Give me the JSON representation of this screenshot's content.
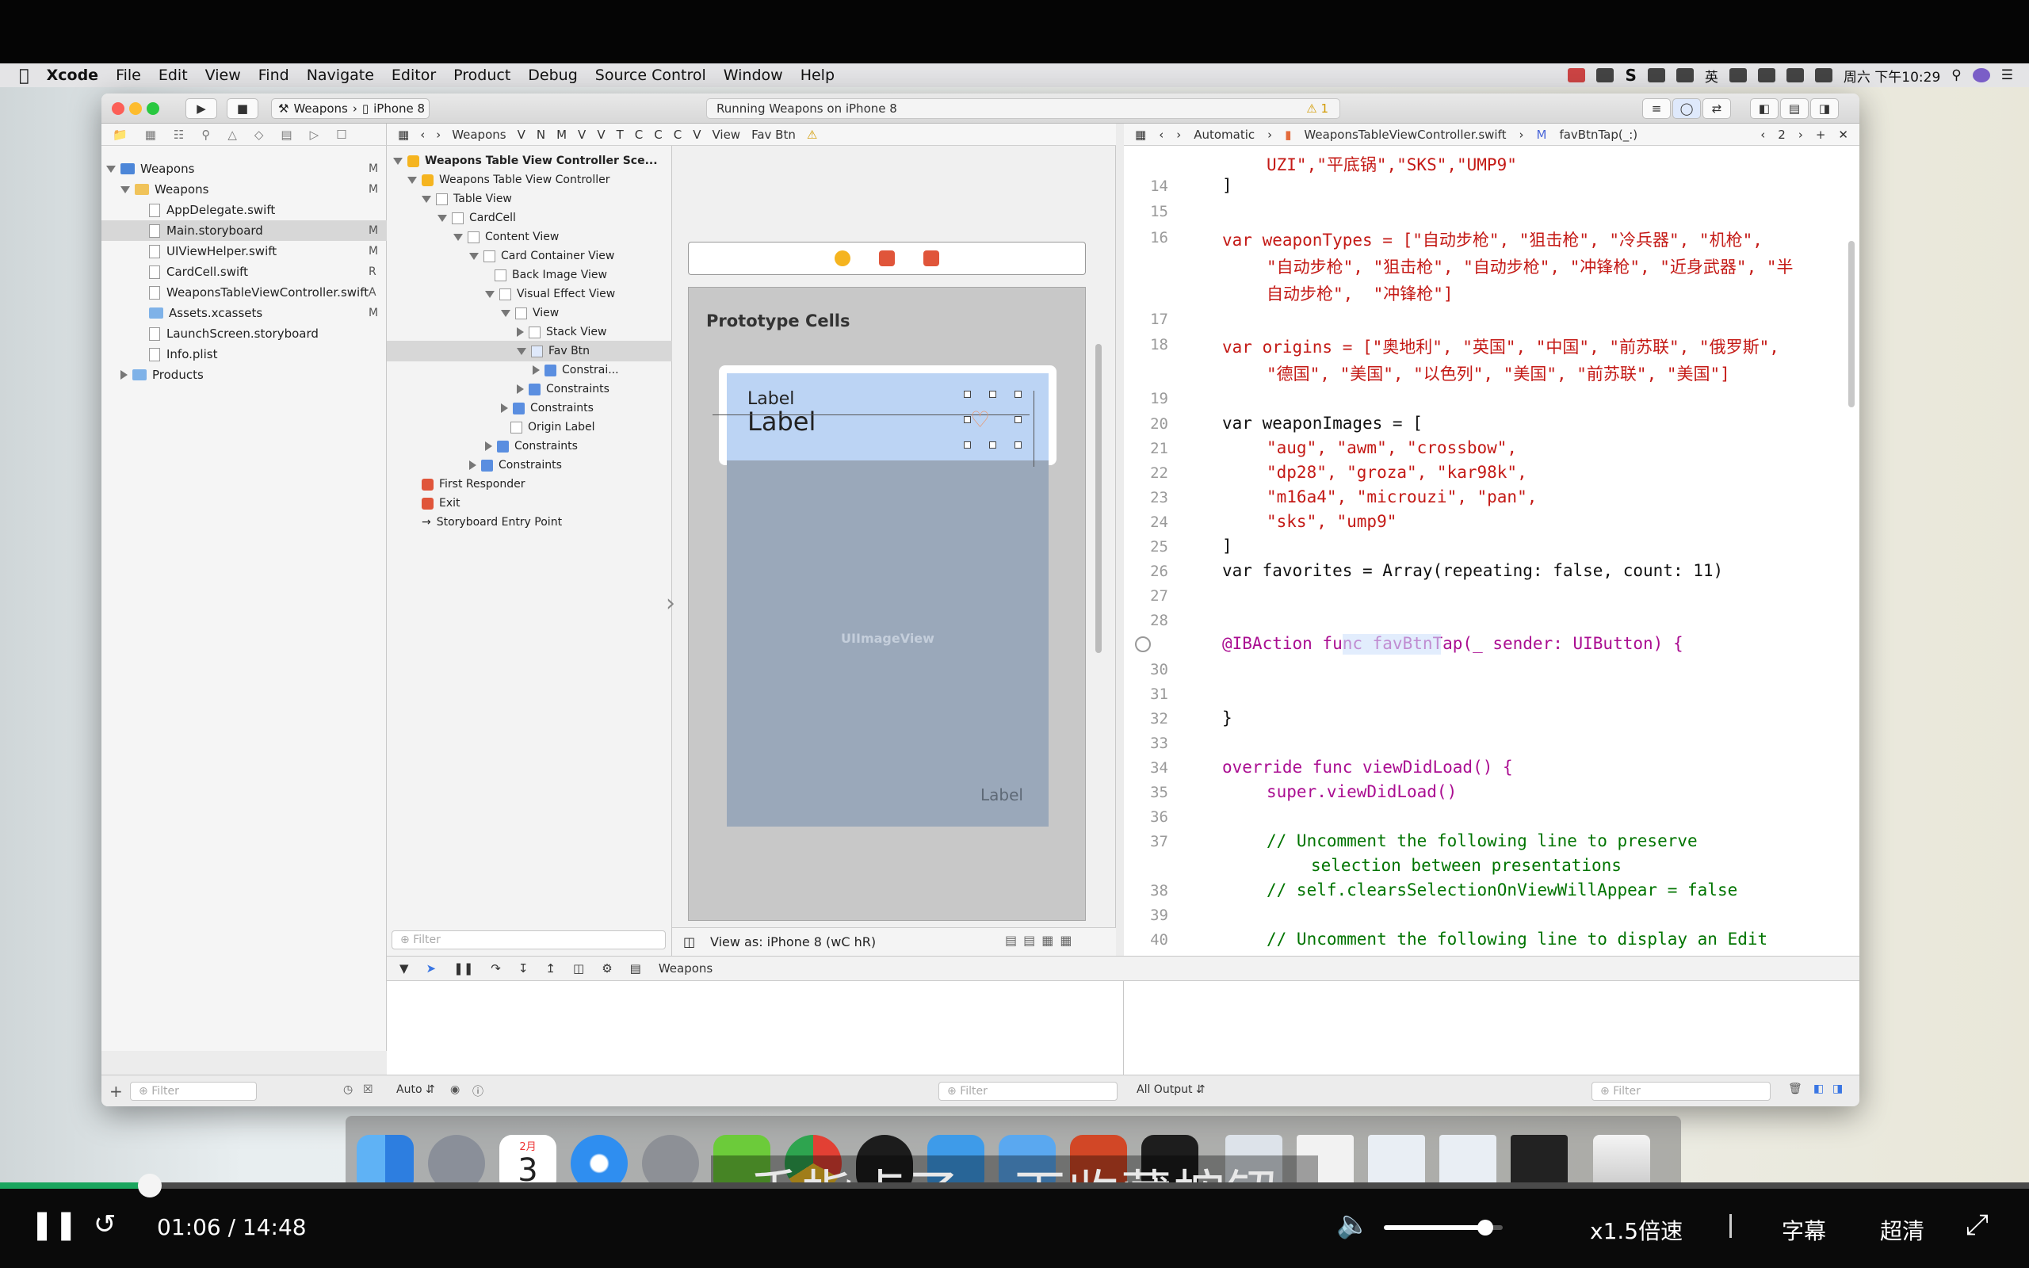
{
  "menubar": {
    "app": "Xcode",
    "items": [
      "File",
      "Edit",
      "View",
      "Find",
      "Navigate",
      "Editor",
      "Product",
      "Debug",
      "Source Control",
      "Window",
      "Help"
    ],
    "clock": "周六 下午10:29",
    "input_method": "英",
    "s_icon": "S"
  },
  "toolbar": {
    "scheme_target": "Weapons",
    "scheme_device": "iPhone 8",
    "status": "Running Weapons on iPhone 8",
    "warnings": "1"
  },
  "navigator": {
    "project": "Weapons",
    "group": "Weapons",
    "files": [
      {
        "name": "AppDelegate.swift",
        "flag": ""
      },
      {
        "name": "Main.storyboard",
        "flag": "M"
      },
      {
        "name": "UIViewHelper.swift",
        "flag": "M"
      },
      {
        "name": "CardCell.swift",
        "flag": "R"
      },
      {
        "name": "WeaponsTableViewController.swift",
        "flag": "A"
      },
      {
        "name": "Assets.xcassets",
        "flag": "M"
      },
      {
        "name": "LaunchScreen.storyboard",
        "flag": ""
      },
      {
        "name": "Info.plist",
        "flag": ""
      }
    ],
    "project_flag": "M",
    "group_flag": "M",
    "products": "Products",
    "filter_placeholder": "Filter"
  },
  "jumpbar": {
    "items": [
      "Weapons",
      "V",
      "N",
      "M",
      "V",
      "V",
      "T",
      "C",
      "C",
      "C",
      "V",
      "View",
      "Fav Btn"
    ]
  },
  "outline": {
    "rows": [
      "Weapons Table View Controller Sce...",
      "Weapons Table View Controller",
      "Table View",
      "CardCell",
      "Content View",
      "Card Container View",
      "Back Image View",
      "Visual Effect View",
      "View",
      "Stack View",
      "Fav Btn",
      "Constrai...",
      "Constraints",
      "Constraints",
      "Origin Label",
      "Constraints",
      "Constraints",
      "First Responder",
      "Exit",
      "Storyboard Entry Point"
    ],
    "filter_placeholder": "Filter"
  },
  "canvas": {
    "prototype_cells": "Prototype Cells",
    "label_small": "Label",
    "label_big": "Label",
    "image_view": "UIImageView",
    "label_bottom": "Label",
    "view_as": "View as: iPhone 8 (wC hR)"
  },
  "editorbar": {
    "mode": "Automatic",
    "file": "WeaponsTableViewController.swift",
    "method": "favBtnTap(_:)",
    "counter": "2"
  },
  "code": {
    "lines": [
      {
        "n": "",
        "text": "UZI\",\"平底锅\",\"SKS\",\"UMP9\""
      },
      {
        "n": "14",
        "text": "]"
      },
      {
        "n": "15",
        "text": ""
      },
      {
        "n": "16",
        "text": "var weaponTypes = [\"自动步枪\", \"狙击枪\", \"冷兵器\", \"机枪\","
      },
      {
        "n": "",
        "text": "\"自动步枪\", \"狙击枪\", \"自动步枪\", \"冲锋枪\", \"近身武器\", \"半"
      },
      {
        "n": "",
        "text": "自动步枪\",  \"冲锋枪\"]"
      },
      {
        "n": "17",
        "text": ""
      },
      {
        "n": "18",
        "text": "var origins = [\"奥地利\", \"英国\", \"中国\", \"前苏联\", \"俄罗斯\","
      },
      {
        "n": "",
        "text": "\"德国\", \"美国\", \"以色列\", \"美国\", \"前苏联\", \"美国\"]"
      },
      {
        "n": "19",
        "text": ""
      },
      {
        "n": "20",
        "text": "var weaponImages = ["
      },
      {
        "n": "21",
        "text": "\"aug\", \"awm\", \"crossbow\","
      },
      {
        "n": "22",
        "text": "\"dp28\", \"groza\", \"kar98k\","
      },
      {
        "n": "23",
        "text": "\"m16a4\", \"microuzi\", \"pan\","
      },
      {
        "n": "24",
        "text": "\"sks\", \"ump9\""
      },
      {
        "n": "25",
        "text": "]"
      },
      {
        "n": "26",
        "text": "var favorites = Array(repeating: false, count: 11)"
      },
      {
        "n": "27",
        "text": ""
      },
      {
        "n": "28",
        "text": ""
      },
      {
        "n": "",
        "text": "@IBAction func favBtnTap(_ sender: UIButton) {"
      },
      {
        "n": "30",
        "text": ""
      },
      {
        "n": "31",
        "text": ""
      },
      {
        "n": "32",
        "text": "}"
      },
      {
        "n": "33",
        "text": ""
      },
      {
        "n": "34",
        "text": "override func viewDidLoad() {"
      },
      {
        "n": "35",
        "text": "super.viewDidLoad()"
      },
      {
        "n": "36",
        "text": ""
      },
      {
        "n": "37",
        "text": "// Uncomment the following line to preserve"
      },
      {
        "n": "",
        "text": "selection between presentations"
      },
      {
        "n": "38",
        "text": "// self.clearsSelectionOnViewWillAppear = false"
      },
      {
        "n": "39",
        "text": ""
      },
      {
        "n": "40",
        "text": "// Uncomment the following line to display an Edit"
      }
    ]
  },
  "debug": {
    "target": "Weapons",
    "auto": "Auto",
    "all_output": "All Output",
    "filter_placeholder": "Filter"
  },
  "dock": {
    "calendar_month": "2月",
    "calendar_day": "3"
  },
  "video": {
    "subtitle": "手指点了一下收藏按钮",
    "time": "01:06 / 14:48",
    "speed": "x1.5倍速",
    "captions": "字幕",
    "quality": "超清",
    "progress": 0.074,
    "volume": 0.85
  },
  "colors": {
    "progress": "#1aa55e",
    "selection": "#bcd4f4",
    "keyword": "#aa0d91",
    "string": "#c41a16",
    "comment": "#007400"
  }
}
